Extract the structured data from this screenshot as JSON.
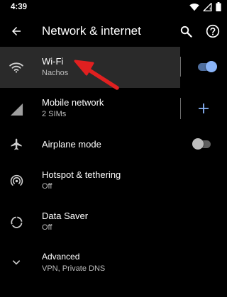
{
  "status_bar": {
    "time": "4:39",
    "icons": [
      "wifi-icon",
      "signal-icon",
      "battery-icon"
    ]
  },
  "toolbar": {
    "title": "Network & internet",
    "back_icon": "arrow-back-icon",
    "search_icon": "search-icon",
    "help_icon": "help-icon"
  },
  "items": [
    {
      "title": "Wi-Fi",
      "subtitle": "Nachos",
      "icon": "wifi-icon",
      "toggle": true,
      "highlighted": true
    },
    {
      "title": "Mobile network",
      "subtitle": "2 SIMs",
      "icon": "signal-icon",
      "action": "add"
    },
    {
      "title": "Airplane mode",
      "subtitle": "",
      "icon": "airplane-icon",
      "toggle": false
    },
    {
      "title": "Hotspot & tethering",
      "subtitle": "Off",
      "icon": "hotspot-icon"
    },
    {
      "title": "Data Saver",
      "subtitle": "Off",
      "icon": "data-saver-icon"
    },
    {
      "title": "Advanced",
      "subtitle": "VPN, Private DNS",
      "icon": "chevron-down-icon"
    }
  ],
  "colors": {
    "background": "#000000",
    "highlight": "#2a2a2a",
    "accent": "#8ab4f8",
    "annotation_arrow": "#e02020"
  }
}
